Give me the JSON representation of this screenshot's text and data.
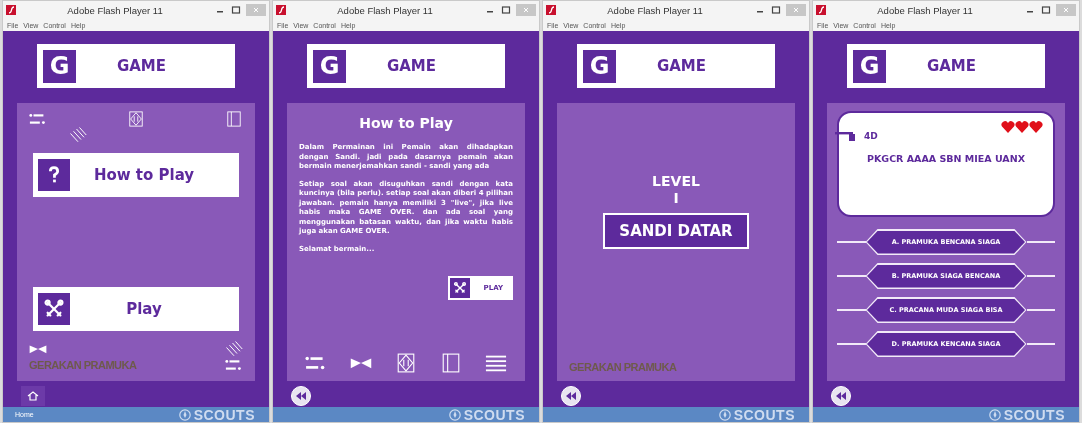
{
  "windows": [
    {
      "title": "Adobe Flash Player 11",
      "menu": [
        "File",
        "View",
        "Control",
        "Help"
      ],
      "header": {
        "letter": "G",
        "title": "GAME"
      },
      "screen": {
        "kind": "menu",
        "buttons": [
          {
            "kind": "help",
            "label": "How to Play"
          },
          {
            "kind": "play",
            "label": "Play"
          }
        ],
        "brand": "GERAKAN PRAMUKA"
      },
      "footer": {
        "kind": "home",
        "back_label": "Home",
        "logo": "SCOUTS"
      }
    },
    {
      "title": "Adobe Flash Player 11",
      "menu": [
        "File",
        "View",
        "Control",
        "Help"
      ],
      "header": {
        "letter": "G",
        "title": "GAME"
      },
      "screen": {
        "kind": "howto",
        "title": "How to Play",
        "paragraphs": [
          "Dalam Permainan ini Pemain akan dihadapkan dengan Sandi. jadi pada dasarnya pemain akan bermain menerjemahkan sandi - sandi yang ada",
          "Setiap soal akan disuguhkan sandi dengan kata kuncinya (bila perlu). setiap soal akan diberi 4 pilihan jawaban. pemain hanya memiliki 3 \"live\", jika live habis maka GAME OVER. dan ada soal yang menggunakan batasan waktu, dan jika waktu habis juga akan GAME OVER.",
          "Selamat bermain..."
        ],
        "play_label": "PLAY"
      },
      "footer": {
        "kind": "rewind",
        "logo": "SCOUTS"
      }
    },
    {
      "title": "Adobe Flash Player 11",
      "menu": [
        "File",
        "View",
        "Control",
        "Help"
      ],
      "header": {
        "letter": "G",
        "title": "GAME"
      },
      "screen": {
        "kind": "level",
        "level_label": "LEVEL",
        "level_number": "I",
        "level_name": "SANDI DATAR",
        "brand": "GERAKAN PRAMUKA"
      },
      "footer": {
        "kind": "rewind",
        "logo": "SCOUTS"
      }
    },
    {
      "title": "Adobe Flash Player 11",
      "menu": [
        "File",
        "View",
        "Control",
        "Help"
      ],
      "header": {
        "letter": "G",
        "title": "GAME"
      },
      "screen": {
        "kind": "quiz",
        "key": "4D",
        "stars": 3,
        "question": "PKGCR AAAA SBN MIEA UANX",
        "answers": [
          "A. PRAMUKA BENCANA SIAGA",
          "B. PRAMUKA SIAGA BENCANA",
          "C. PRACANA MUDA SIAGA BISA",
          "D. PRAMUKA KENCANA SIAGA"
        ]
      },
      "footer": {
        "kind": "rewind",
        "logo": "SCOUTS"
      }
    }
  ]
}
